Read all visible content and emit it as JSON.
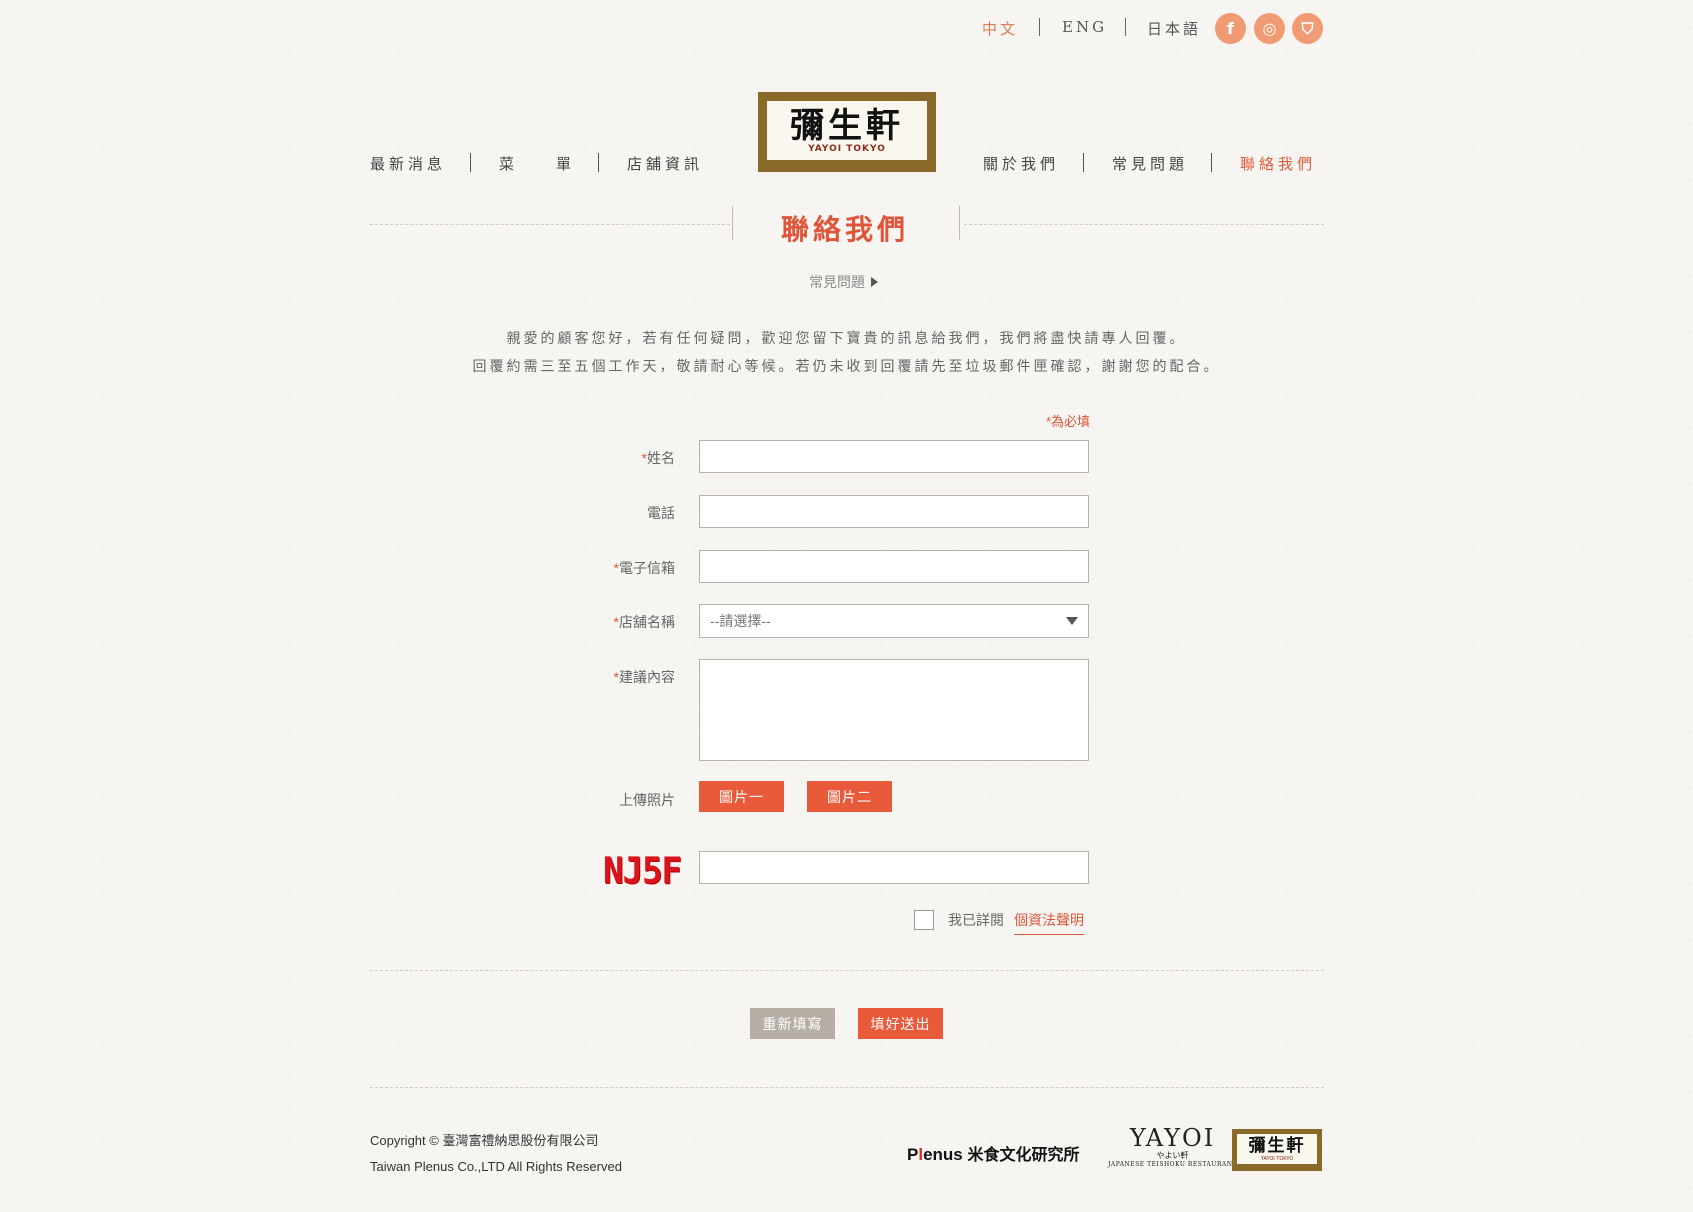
{
  "languages": [
    {
      "label": "中文"
    },
    {
      "label": "ENG"
    },
    {
      "label": "日本語"
    }
  ],
  "social": [
    {
      "glyph": "f",
      "icon": "facebook-icon"
    },
    {
      "glyph": "◎",
      "icon": "instagram-icon"
    },
    {
      "glyph": "⛉",
      "icon": "shopping-bag-icon"
    }
  ],
  "logo": {
    "main": "彌生軒",
    "sub": "YAYOI TOKYO"
  },
  "nav": {
    "left": [
      "最新消息",
      "菜　　單",
      "店舖資訊"
    ],
    "right": [
      "關於我們",
      "常見問題",
      "聯絡我們"
    ]
  },
  "page": {
    "title": "聯絡我們",
    "faq_link": "常見問題",
    "intro_line1": "親愛的顧客您好，若有任何疑問，歡迎您留下寶貴的訊息給我們，我們將盡快請專人回覆。",
    "intro_line2": "回覆約需三至五個工作天，敬請耐心等候。若仍未收到回覆請先至垃圾郵件匣確認，謝謝您的配合。"
  },
  "form": {
    "required_note": "*為必填",
    "name_label": "姓名",
    "phone_label": "電話",
    "email_label": "電子信箱",
    "store_label": "店舖名稱",
    "store_selected": "--請選擇--",
    "message_label": "建議內容",
    "upload_label": "上傳照片",
    "upload_btn1": "圖片一",
    "upload_btn2": "圖片二",
    "captcha_text": "NJ5F",
    "agree_text": "我已詳閱",
    "privacy_link": "個資法聲明",
    "reset_btn": "重新填寫",
    "submit_btn": "填好送出"
  },
  "footer": {
    "copyright_cn": "Copyright © 臺灣富禮納思股份有限公司",
    "copyright_en": "Taiwan Plenus Co.,LTD All Rights Reserved",
    "plenus_p": "P",
    "plenus_l": "l",
    "plenus_rest": "enus",
    "plenus_cn": "米食文化研究所",
    "yayoi_big": "YAYOI",
    "yayoi_mid": "やよい軒",
    "yayoi_small": "JAPANESE TEISHOKU RESTAURANT",
    "logo_main": "彌生軒",
    "logo_sub": "YAYOI TOKYO"
  },
  "colors": {
    "accent": "#e0553a",
    "button_red": "#e95a3a",
    "button_grey": "#b7aea6",
    "logo_gold": "#8a6a28",
    "social": "#f19b74"
  }
}
